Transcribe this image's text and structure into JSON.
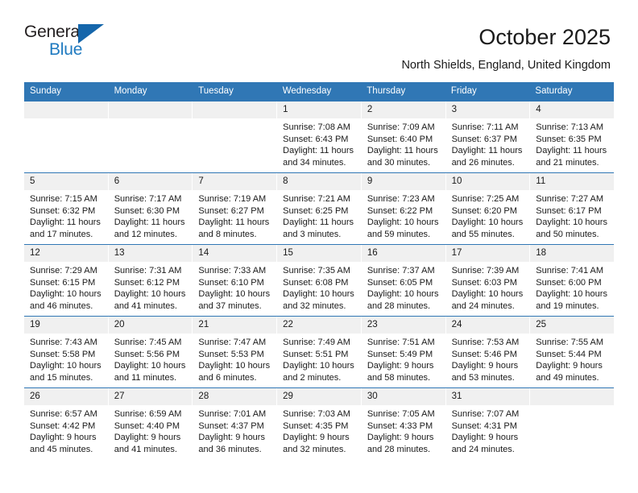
{
  "brand": {
    "name_part1": "General",
    "name_part2": "Blue",
    "triangle_color": "#1566ab",
    "blue_text_color": "#1f7ac0",
    "icon": "triangle-logo-icon"
  },
  "header": {
    "title": "October 2025",
    "location": "North Shields, England, United Kingdom"
  },
  "theme": {
    "header_bar_color": "#3077b5",
    "day_band_color": "#f0f0f0",
    "text_color": "#1a1a1a",
    "page_background": "#ffffff"
  },
  "weekdays": [
    "Sunday",
    "Monday",
    "Tuesday",
    "Wednesday",
    "Thursday",
    "Friday",
    "Saturday"
  ],
  "weeks": [
    [
      {
        "date": "",
        "empty": true,
        "lines": []
      },
      {
        "date": "",
        "empty": true,
        "lines": []
      },
      {
        "date": "",
        "empty": true,
        "lines": []
      },
      {
        "date": "1",
        "empty": false,
        "lines": [
          "Sunrise: 7:08 AM",
          "Sunset: 6:43 PM",
          "Daylight: 11 hours",
          "and 34 minutes."
        ]
      },
      {
        "date": "2",
        "empty": false,
        "lines": [
          "Sunrise: 7:09 AM",
          "Sunset: 6:40 PM",
          "Daylight: 11 hours",
          "and 30 minutes."
        ]
      },
      {
        "date": "3",
        "empty": false,
        "lines": [
          "Sunrise: 7:11 AM",
          "Sunset: 6:37 PM",
          "Daylight: 11 hours",
          "and 26 minutes."
        ]
      },
      {
        "date": "4",
        "empty": false,
        "lines": [
          "Sunrise: 7:13 AM",
          "Sunset: 6:35 PM",
          "Daylight: 11 hours",
          "and 21 minutes."
        ]
      }
    ],
    [
      {
        "date": "5",
        "empty": false,
        "lines": [
          "Sunrise: 7:15 AM",
          "Sunset: 6:32 PM",
          "Daylight: 11 hours",
          "and 17 minutes."
        ]
      },
      {
        "date": "6",
        "empty": false,
        "lines": [
          "Sunrise: 7:17 AM",
          "Sunset: 6:30 PM",
          "Daylight: 11 hours",
          "and 12 minutes."
        ]
      },
      {
        "date": "7",
        "empty": false,
        "lines": [
          "Sunrise: 7:19 AM",
          "Sunset: 6:27 PM",
          "Daylight: 11 hours",
          "and 8 minutes."
        ]
      },
      {
        "date": "8",
        "empty": false,
        "lines": [
          "Sunrise: 7:21 AM",
          "Sunset: 6:25 PM",
          "Daylight: 11 hours",
          "and 3 minutes."
        ]
      },
      {
        "date": "9",
        "empty": false,
        "lines": [
          "Sunrise: 7:23 AM",
          "Sunset: 6:22 PM",
          "Daylight: 10 hours",
          "and 59 minutes."
        ]
      },
      {
        "date": "10",
        "empty": false,
        "lines": [
          "Sunrise: 7:25 AM",
          "Sunset: 6:20 PM",
          "Daylight: 10 hours",
          "and 55 minutes."
        ]
      },
      {
        "date": "11",
        "empty": false,
        "lines": [
          "Sunrise: 7:27 AM",
          "Sunset: 6:17 PM",
          "Daylight: 10 hours",
          "and 50 minutes."
        ]
      }
    ],
    [
      {
        "date": "12",
        "empty": false,
        "lines": [
          "Sunrise: 7:29 AM",
          "Sunset: 6:15 PM",
          "Daylight: 10 hours",
          "and 46 minutes."
        ]
      },
      {
        "date": "13",
        "empty": false,
        "lines": [
          "Sunrise: 7:31 AM",
          "Sunset: 6:12 PM",
          "Daylight: 10 hours",
          "and 41 minutes."
        ]
      },
      {
        "date": "14",
        "empty": false,
        "lines": [
          "Sunrise: 7:33 AM",
          "Sunset: 6:10 PM",
          "Daylight: 10 hours",
          "and 37 minutes."
        ]
      },
      {
        "date": "15",
        "empty": false,
        "lines": [
          "Sunrise: 7:35 AM",
          "Sunset: 6:08 PM",
          "Daylight: 10 hours",
          "and 32 minutes."
        ]
      },
      {
        "date": "16",
        "empty": false,
        "lines": [
          "Sunrise: 7:37 AM",
          "Sunset: 6:05 PM",
          "Daylight: 10 hours",
          "and 28 minutes."
        ]
      },
      {
        "date": "17",
        "empty": false,
        "lines": [
          "Sunrise: 7:39 AM",
          "Sunset: 6:03 PM",
          "Daylight: 10 hours",
          "and 24 minutes."
        ]
      },
      {
        "date": "18",
        "empty": false,
        "lines": [
          "Sunrise: 7:41 AM",
          "Sunset: 6:00 PM",
          "Daylight: 10 hours",
          "and 19 minutes."
        ]
      }
    ],
    [
      {
        "date": "19",
        "empty": false,
        "lines": [
          "Sunrise: 7:43 AM",
          "Sunset: 5:58 PM",
          "Daylight: 10 hours",
          "and 15 minutes."
        ]
      },
      {
        "date": "20",
        "empty": false,
        "lines": [
          "Sunrise: 7:45 AM",
          "Sunset: 5:56 PM",
          "Daylight: 10 hours",
          "and 11 minutes."
        ]
      },
      {
        "date": "21",
        "empty": false,
        "lines": [
          "Sunrise: 7:47 AM",
          "Sunset: 5:53 PM",
          "Daylight: 10 hours",
          "and 6 minutes."
        ]
      },
      {
        "date": "22",
        "empty": false,
        "lines": [
          "Sunrise: 7:49 AM",
          "Sunset: 5:51 PM",
          "Daylight: 10 hours",
          "and 2 minutes."
        ]
      },
      {
        "date": "23",
        "empty": false,
        "lines": [
          "Sunrise: 7:51 AM",
          "Sunset: 5:49 PM",
          "Daylight: 9 hours",
          "and 58 minutes."
        ]
      },
      {
        "date": "24",
        "empty": false,
        "lines": [
          "Sunrise: 7:53 AM",
          "Sunset: 5:46 PM",
          "Daylight: 9 hours",
          "and 53 minutes."
        ]
      },
      {
        "date": "25",
        "empty": false,
        "lines": [
          "Sunrise: 7:55 AM",
          "Sunset: 5:44 PM",
          "Daylight: 9 hours",
          "and 49 minutes."
        ]
      }
    ],
    [
      {
        "date": "26",
        "empty": false,
        "lines": [
          "Sunrise: 6:57 AM",
          "Sunset: 4:42 PM",
          "Daylight: 9 hours",
          "and 45 minutes."
        ]
      },
      {
        "date": "27",
        "empty": false,
        "lines": [
          "Sunrise: 6:59 AM",
          "Sunset: 4:40 PM",
          "Daylight: 9 hours",
          "and 41 minutes."
        ]
      },
      {
        "date": "28",
        "empty": false,
        "lines": [
          "Sunrise: 7:01 AM",
          "Sunset: 4:37 PM",
          "Daylight: 9 hours",
          "and 36 minutes."
        ]
      },
      {
        "date": "29",
        "empty": false,
        "lines": [
          "Sunrise: 7:03 AM",
          "Sunset: 4:35 PM",
          "Daylight: 9 hours",
          "and 32 minutes."
        ]
      },
      {
        "date": "30",
        "empty": false,
        "lines": [
          "Sunrise: 7:05 AM",
          "Sunset: 4:33 PM",
          "Daylight: 9 hours",
          "and 28 minutes."
        ]
      },
      {
        "date": "31",
        "empty": false,
        "lines": [
          "Sunrise: 7:07 AM",
          "Sunset: 4:31 PM",
          "Daylight: 9 hours",
          "and 24 minutes."
        ]
      },
      {
        "date": "",
        "empty": true,
        "lines": []
      }
    ]
  ]
}
